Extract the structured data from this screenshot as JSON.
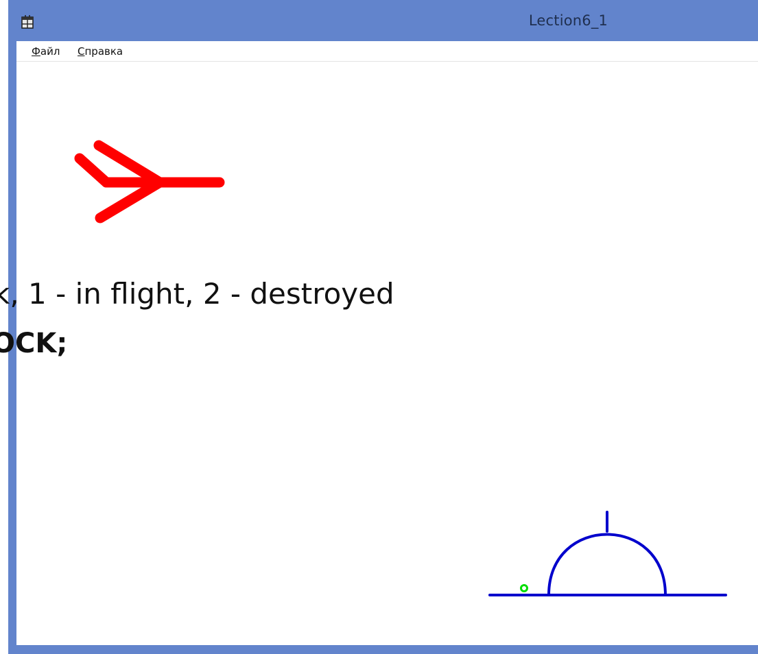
{
  "window": {
    "title": "Lection6_1",
    "icon": "app-window-icon",
    "frame_color": "#6284cc"
  },
  "menu": {
    "items": [
      {
        "label": "Файл",
        "accel": "Ф",
        "rest": "айл"
      },
      {
        "label": "Справка",
        "accel": "С",
        "rest": "правка"
      }
    ]
  },
  "scene": {
    "plane": {
      "icon": "plane-icon",
      "color": "#ff0000"
    },
    "cannon": {
      "icon": "cannon-turret-icon",
      "color": "#0000cc"
    },
    "shell": {
      "icon": "shell-icon",
      "color": "#00dd00"
    }
  },
  "overlay": {
    "line1": "k, 1 - in flight, 2 - destroyed",
    "line2": "OCK;"
  }
}
